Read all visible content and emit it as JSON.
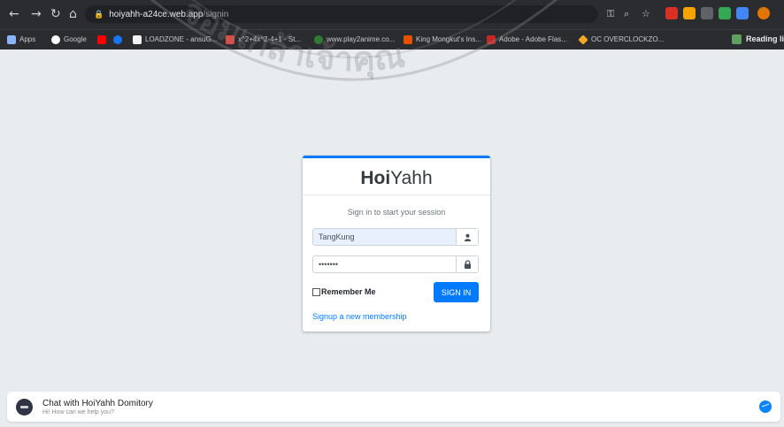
{
  "browser": {
    "url_host": "hoiyahh-a24ce.web.app",
    "url_path": "/signin",
    "bookmarks": [
      {
        "label": "Apps",
        "color": "#8ab4f8"
      },
      {
        "label": "Google",
        "color": "#ffffff"
      },
      {
        "label": "",
        "color": "#ff0000"
      },
      {
        "label": "",
        "color": "#1877f2"
      },
      {
        "label": "LOADZONE - ansuG...",
        "color": "#f2f2f2"
      },
      {
        "label": "x^2+4x^2-4+1 - St...",
        "color": "#e8443a"
      },
      {
        "label": "www.play2anime.co...",
        "color": "#2e7d32"
      },
      {
        "label": "King Mongkut's Ins...",
        "color": "#e65100"
      },
      {
        "label": "Adobe - Adobe Flas...",
        "color": "#c62828"
      },
      {
        "label": "OC OVERCLOCKZO...",
        "color": "#f9a825"
      }
    ],
    "reading_list": "Reading li"
  },
  "watermark": {
    "text": "จอมเกล้าเจ้าคุณ"
  },
  "login": {
    "brand_bold": "Hoi",
    "brand_light": "Yahh",
    "message": "Sign in to start your session",
    "username_value": "TangKung",
    "password_value": "•••••••",
    "remember_label": "Remember Me",
    "signin_label": "SIGN IN",
    "signup_link": "Signup a new membership"
  },
  "chat": {
    "title": "Chat with HoiYahh Domitory",
    "subtitle": "Hi! How can we help you?"
  },
  "colors": {
    "primary": "#007bff",
    "chrome": "#2b2c30",
    "page_bg": "#e9ecef"
  }
}
